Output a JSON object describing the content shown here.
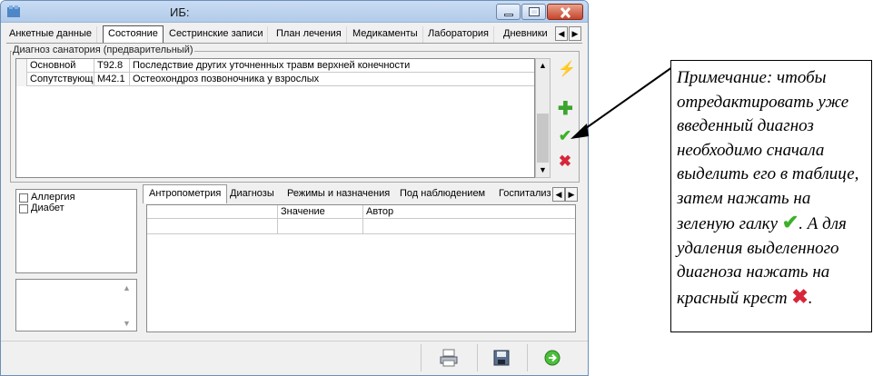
{
  "window": {
    "title": "ИБ:"
  },
  "tabs": [
    {
      "label": "Анкетные данные",
      "active": false
    },
    {
      "label": "Состояние",
      "active": true
    },
    {
      "label": "Сестринские записи",
      "active": false
    },
    {
      "label": "План лечения",
      "active": false
    },
    {
      "label": "Медикаменты",
      "active": false
    },
    {
      "label": "Лаборатория",
      "active": false
    },
    {
      "label": "Дневники",
      "active": false
    }
  ],
  "diagnosis": {
    "group_label": "Диагноз санатория (предварительный)",
    "rows": [
      {
        "type": "Основной",
        "code": "T92.8",
        "name": "Последствие других уточненных травм верхней конечности"
      },
      {
        "type": "Сопутствующ",
        "code": "M42.1",
        "name": "Остеохондроз позвоночника у взрослых"
      }
    ]
  },
  "side_actions": {
    "lightning": "lightning-icon",
    "add": "plus-icon",
    "edit": "check-icon",
    "delete": "cross-icon"
  },
  "checkboxes": [
    {
      "label": "Аллергия",
      "checked": false
    },
    {
      "label": "Диабет",
      "checked": false
    }
  ],
  "bottom_tabs": [
    {
      "label": "Антропометрия",
      "active": true
    },
    {
      "label": "Диагнозы",
      "active": false
    },
    {
      "label": "Режимы и назначения",
      "active": false
    },
    {
      "label": "Под наблюдением",
      "active": false
    },
    {
      "label": "Госпитализ",
      "active": false
    }
  ],
  "grid": {
    "columns": [
      "",
      "Значение",
      "Автор"
    ]
  },
  "footer_icons": [
    "printer-icon",
    "save-icon",
    "exit-icon"
  ],
  "note": {
    "part1": "Примечание: чтобы отредактировать уже введенный диагноз необходимо сначала выделить его в таблице, затем нажать на зеленую галку ",
    "part2": ". А для удаления выделенного диагноза нажать на красный крест ",
    "part3": "."
  },
  "colors": {
    "check": "#3cb028",
    "cross": "#d7263a",
    "plus": "#3aa52d",
    "lightning": "#e7b61c"
  }
}
